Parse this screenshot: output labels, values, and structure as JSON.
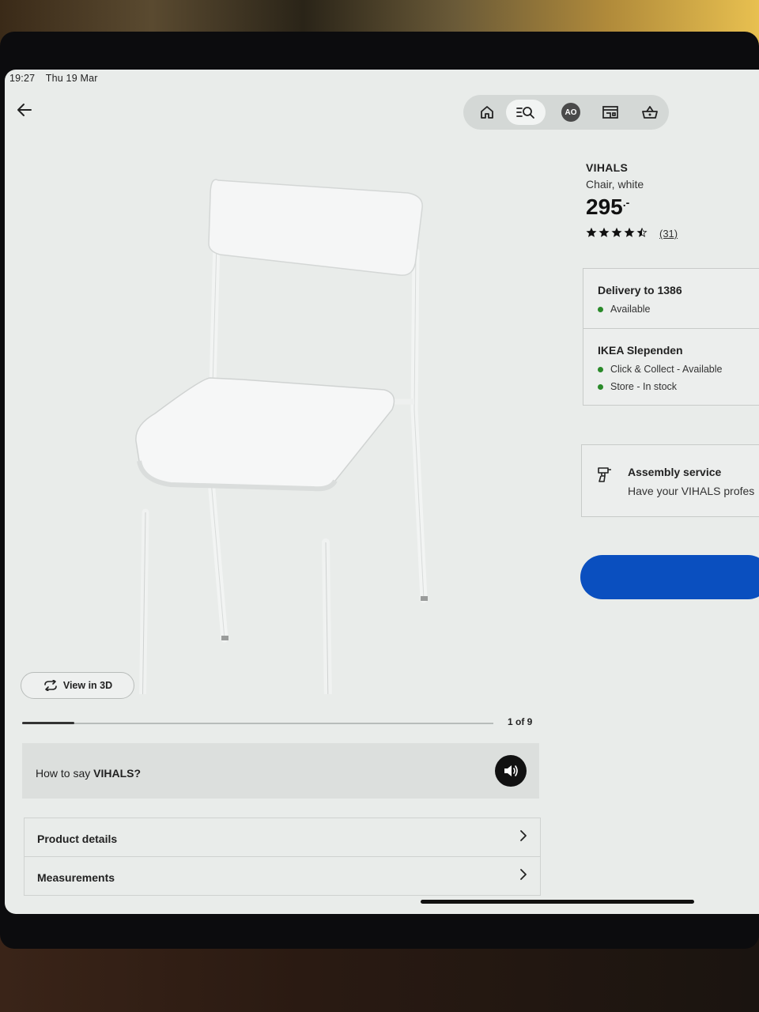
{
  "status_bar": {
    "time": "19:27",
    "date": "Thu 19 Mar"
  },
  "nav": {
    "avatar_initials": "AO"
  },
  "gallery": {
    "view_3d_label": "View in 3D",
    "page_indicator": "1 of 9",
    "progress_fraction": 0.11
  },
  "pronounce": {
    "prefix": "How to say ",
    "name": "VIHALS?"
  },
  "accordion": {
    "product_details": "Product details",
    "measurements": "Measurements"
  },
  "product": {
    "name": "VIHALS",
    "description": "Chair, white",
    "price": "295",
    "price_suffix": ".-",
    "rating": 4.5,
    "review_count": "(31)"
  },
  "delivery": {
    "title": "Delivery to  1386",
    "status": "Available"
  },
  "store": {
    "title": "IKEA Slependen",
    "click_collect": "Click & Collect - Available",
    "in_store": "Store - In stock"
  },
  "assembly": {
    "title": "Assembly service",
    "subtitle": "Have your VIHALS profes"
  },
  "colors": {
    "accent": "#0a4fbf",
    "available": "#2a8a2a"
  }
}
